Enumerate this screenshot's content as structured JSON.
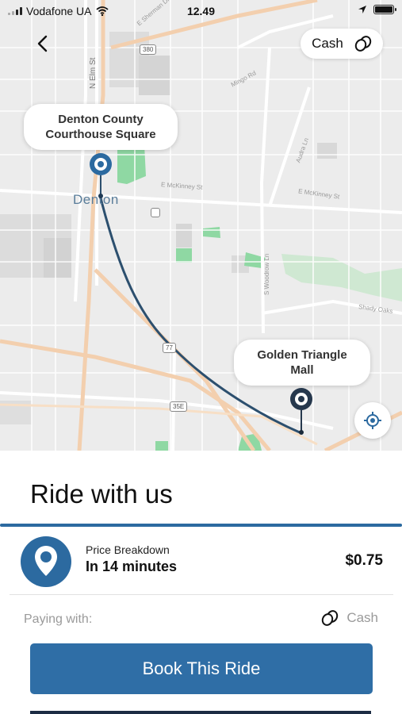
{
  "status_bar": {
    "carrier": "Vodafone UA",
    "time": "12.49",
    "icons": [
      "signal-icon",
      "wifi-icon",
      "location-arrow-icon",
      "battery-icon"
    ]
  },
  "map": {
    "city_label": "Denton",
    "street_labels": {
      "elm": "N Elm St",
      "mckinney_w": "E McKinney St",
      "mckinney_e": "E McKinney St",
      "mingo": "Mingo Rd",
      "audra": "Audra Ln",
      "woodrow": "S Woodrow Ln",
      "shady": "Shady Oaks",
      "shallow": "E Sherman Dr"
    },
    "highway_shields": {
      "h380": "380",
      "h77": "77",
      "h35e": "35E"
    },
    "origin": {
      "label_line1": "Denton County",
      "label_line2": "Courthouse Square"
    },
    "destination": {
      "label_line1": "Golden Triangle",
      "label_line2": "Mall"
    },
    "route_color": "#2c4f6e"
  },
  "top_bar": {
    "payment_chip_label": "Cash"
  },
  "sheet": {
    "title": "Ride with us",
    "ride_subtitle": "Price Breakdown",
    "ride_eta": "In 14 minutes",
    "ride_price": "$0.75",
    "paying_label": "Paying with:",
    "paying_method": "Cash",
    "book_button": "Book This Ride"
  },
  "colors": {
    "accent": "#2c6aa0",
    "button": "#2f6ea6",
    "map_bg": "#ececec",
    "park": "#8fd8a3"
  }
}
